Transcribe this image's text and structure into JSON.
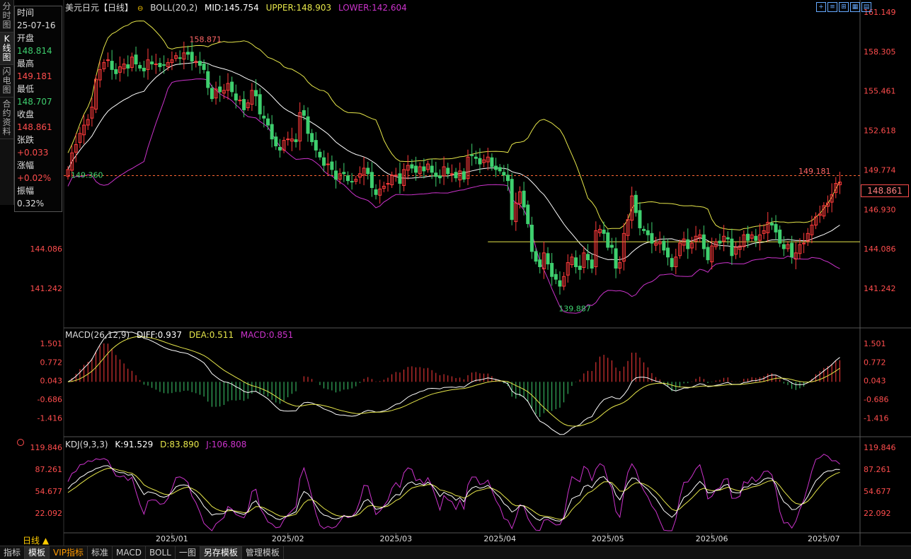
{
  "sidebar": {
    "tabs": [
      "分时图",
      "K线图",
      "闪电图",
      "合约资料"
    ],
    "active": 1
  },
  "info_panel": {
    "time_label": "时间",
    "time_value": "25-07-16",
    "open_label": "开盘",
    "open_value": "148.814",
    "high_label": "最高",
    "high_value": "149.181",
    "low_label": "最低",
    "low_value": "148.707",
    "close_label": "收盘",
    "close_value": "148.861",
    "change_label": "张跌",
    "change_value": "+0.033",
    "pct_label": "涨幅",
    "pct_value": "+0.02%",
    "amp_label": "振幅",
    "amp_value": "0.32%"
  },
  "main_header": {
    "symbol": "美元日元【日线】",
    "symbol_icon": "circle-icon",
    "boll": "BOLL(20,2)",
    "mid": "MID:145.754",
    "upper": "UPPER:148.903",
    "lower": "LOWER:142.604"
  },
  "macd_header": {
    "name": "MACD(26,12,9)",
    "diff": "DIFF:0.937",
    "dea": "DEA:0.511",
    "macd": "MACD:0.851"
  },
  "kdj_header": {
    "name": "KDJ(9,3,3)",
    "k": "K:91.529",
    "d": "D:83.890",
    "j": "J:106.808"
  },
  "current_price": "148.861",
  "bottom_bar": {
    "period_label": "日线 ▲",
    "items": [
      "指标",
      "模板",
      "VIP指标",
      "标准",
      "MACD",
      "BOLL",
      "一图",
      "另存模板",
      "管理模板"
    ],
    "active": [
      1,
      7
    ],
    "vip": 2
  },
  "colors": {
    "up": "#ff3b3b",
    "down": "#3ecf6e",
    "mid": "#ffffff",
    "upper": "#e6e64a",
    "lower": "#cc33cc",
    "bg": "#000000"
  },
  "chart_data": [
    {
      "type": "candlestick",
      "name": "price",
      "y_axis_ticks": [
        "161.149",
        "158.305",
        "155.461",
        "152.618",
        "149.774",
        "146.930",
        "144.086",
        "141.242"
      ],
      "ylim": [
        138.5,
        161.6
      ],
      "x_axis_ticks": [
        "2025/01",
        "2025/02",
        "2025/03",
        "2025/04",
        "2025/05",
        "2025/06",
        "2025/07"
      ],
      "x_tick_index": [
        26,
        55,
        82,
        108,
        135,
        161,
        189
      ],
      "annotations": {
        "high_label": "158.871",
        "high_index": 30,
        "high_value": 158.871,
        "low_label": "139.887",
        "low_index": 122,
        "low_value": 139.887,
        "left_label": "149.360",
        "left_value": 149.36,
        "last_high_label": "149.181",
        "last_high_value": 149.181
      },
      "reference_lines": {
        "dashed_value": 149.36,
        "solid_value": 144.6,
        "solid_start_index": 105
      },
      "closes": [
        149.8,
        151.0,
        151.6,
        152.4,
        153.0,
        153.4,
        154.3,
        156.3,
        157.0,
        157.5,
        157.7,
        157.0,
        156.7,
        157.2,
        157.4,
        157.1,
        157.9,
        157.4,
        157.1,
        156.9,
        157.7,
        157.4,
        157.4,
        157.2,
        157.3,
        157.5,
        157.7,
        158.0,
        157.8,
        158.2,
        158.1,
        157.6,
        157.6,
        157.3,
        157.0,
        155.7,
        154.9,
        155.6,
        155.4,
        155.5,
        156.0,
        155.4,
        154.8,
        154.8,
        154.1,
        154.6,
        155.5,
        155.1,
        153.8,
        153.5,
        153.0,
        152.0,
        151.5,
        151.2,
        151.9,
        152.0,
        152.0,
        151.8,
        153.9,
        153.7,
        152.4,
        151.8,
        151.2,
        150.7,
        150.1,
        150.2,
        149.8,
        149.1,
        149.5,
        149.5,
        149.0,
        148.9,
        149.1,
        149.5,
        149.9,
        149.5,
        148.5,
        148.0,
        148.4,
        148.6,
        148.8,
        149.4,
        149.4,
        148.8,
        149.8,
        150.1,
        149.9,
        149.6,
        150.0,
        149.7,
        150.2,
        149.6,
        149.3,
        149.2,
        150.0,
        149.5,
        149.5,
        149.2,
        149.7,
        149.1,
        150.7,
        150.8,
        150.6,
        150.2,
        150.5,
        150.7,
        150.0,
        149.8,
        149.7,
        149.4,
        149.0,
        146.2,
        147.4,
        148.2,
        147.1,
        145.9,
        143.9,
        143.2,
        142.8,
        143.8,
        143.0,
        142.1,
        141.9,
        141.4,
        142.1,
        143.1,
        143.5,
        142.8,
        142.6,
        143.8,
        143.3,
        142.7,
        145.4,
        145.5,
        145.2,
        144.2,
        144.2,
        142.7,
        143.1,
        145.2,
        146.2,
        147.9,
        146.7,
        145.6,
        145.4,
        145.1,
        144.5,
        144.5,
        144.6,
        144.0,
        143.5,
        142.8,
        143.5,
        144.5,
        144.8,
        144.1,
        144.5,
        145.0,
        145.1,
        144.1,
        143.3,
        144.3,
        144.6,
        144.5,
        145.0,
        144.8,
        143.6,
        144.2,
        144.3,
        145.1,
        144.7,
        145.1,
        144.7,
        145.1,
        145.4,
        146.0,
        145.8,
        145.3,
        144.5,
        144.1,
        144.4,
        143.5,
        143.8,
        144.4,
        144.5,
        145.2,
        145.8,
        146.4,
        146.6,
        147.2,
        147.4,
        148.0,
        148.8,
        148.9
      ]
    },
    {
      "type": "bar",
      "name": "MACD",
      "y_axis_ticks": [
        "1.501",
        "0.772",
        "0.043",
        "-0.686",
        "-1.416"
      ],
      "ylim": [
        -2.1,
        1.95
      ],
      "series": [
        {
          "name": "DIFF",
          "value": 0.937
        },
        {
          "name": "DEA",
          "value": 0.511
        },
        {
          "name": "MACD",
          "value": 0.851
        }
      ]
    },
    {
      "type": "line",
      "name": "KDJ",
      "y_axis_ticks": [
        "119.846",
        "87.261",
        "54.677",
        "22.092"
      ],
      "ylim": [
        -5,
        125
      ],
      "series": [
        {
          "name": "K",
          "value": 91.529
        },
        {
          "name": "D",
          "value": 83.89
        },
        {
          "name": "J",
          "value": 106.808
        }
      ]
    }
  ]
}
